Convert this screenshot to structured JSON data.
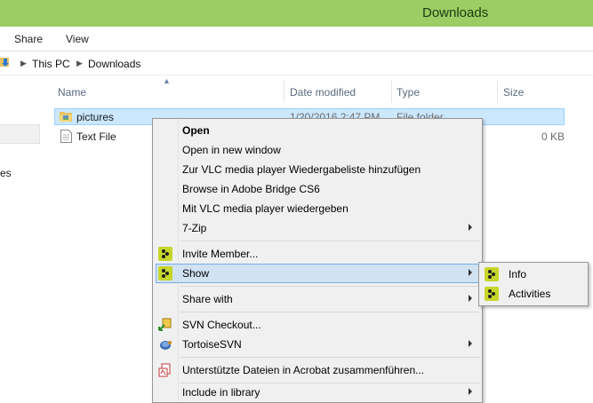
{
  "window": {
    "title": "Downloads"
  },
  "ribbon": {
    "tabs": [
      "Share",
      "View"
    ]
  },
  "address": {
    "crumbs": [
      "This PC",
      "Downloads"
    ]
  },
  "nav": {
    "partial_label": "es"
  },
  "columns": {
    "name": "Name",
    "date": "Date modified",
    "type": "Type",
    "size": "Size"
  },
  "files": [
    {
      "name": "pictures",
      "date": "1/20/2016 2:47 PM",
      "type": "File folder",
      "size": "",
      "icon": "folder-icon"
    },
    {
      "name": "Text File",
      "date": "",
      "type": "",
      "size": "0 KB",
      "icon": "text-file-icon"
    }
  ],
  "context_menu": {
    "open": "Open",
    "open_new_window": "Open in new window",
    "vlc_add_playlist": "Zur VLC media player Wiedergabeliste hinzufügen",
    "adobe_bridge": "Browse in Adobe Bridge CS6",
    "vlc_play": "Mit VLC media player wiedergeben",
    "seven_zip": "7-Zip",
    "invite_member": "Invite Member...",
    "show": "Show",
    "share_with": "Share with",
    "svn_checkout": "SVN Checkout...",
    "tortoise_svn": "TortoiseSVN",
    "acrobat_merge": "Unterstützte Dateien in Acrobat zusammenführen...",
    "include_library": "Include in library"
  },
  "submenu": {
    "info": "Info",
    "activities": "Activities"
  },
  "colors": {
    "titlebar": "#9ccc64",
    "selection": "#cce8ff",
    "menu_highlight": "#d1e2f2"
  }
}
